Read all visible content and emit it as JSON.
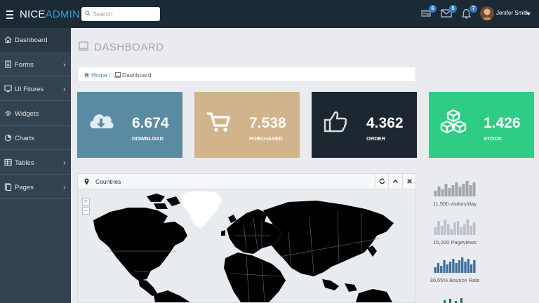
{
  "brand": {
    "part1": "NICE",
    "part2": "ADMIN"
  },
  "search": {
    "placeholder": "Search"
  },
  "notifications": [
    {
      "icon": "tasks-icon",
      "count": "6"
    },
    {
      "icon": "mail-icon",
      "count": "5"
    },
    {
      "icon": "bell-icon",
      "count": "7"
    }
  ],
  "user": {
    "name": "Jenifer Smith"
  },
  "sidebar": {
    "items": [
      {
        "label": "Dashboard",
        "icon": "home-icon",
        "has_submenu": false,
        "active": true
      },
      {
        "label": "Forms",
        "icon": "document-icon",
        "has_submenu": true
      },
      {
        "label": "UI Fitures",
        "icon": "desktop-icon",
        "has_submenu": true
      },
      {
        "label": "Widgets",
        "icon": "gear-icon",
        "has_submenu": false
      },
      {
        "label": "Charts",
        "icon": "pie-chart-icon",
        "has_submenu": false
      },
      {
        "label": "Tables",
        "icon": "table-icon",
        "has_submenu": true
      },
      {
        "label": "Pages",
        "icon": "pages-icon",
        "has_submenu": true
      }
    ]
  },
  "page": {
    "title": "DASHBOARD"
  },
  "breadcrumb": {
    "home": "Home",
    "separator": "/",
    "current": "Dashboard"
  },
  "tiles": [
    {
      "value": "6.674",
      "label": "DOWNLOAD",
      "icon": "cloud-download-icon",
      "color": "#5b8aa3"
    },
    {
      "value": "7.538",
      "label": "PURCHASED",
      "icon": "shopping-cart-icon",
      "color": "#d2b48c"
    },
    {
      "value": "4.362",
      "label": "ORDER",
      "icon": "thumbs-up-icon",
      "color": "#1d2730"
    },
    {
      "value": "1.426",
      "label": "STOCK",
      "icon": "cubes-icon",
      "color": "#2ecc84"
    }
  ],
  "map_panel": {
    "title": "Countries",
    "zoom_in": "+",
    "zoom_out": "−"
  },
  "stats": [
    {
      "caption": "11,500 visitors/day",
      "color": "#a0a6ad",
      "values": [
        4,
        7,
        5,
        9,
        6,
        8,
        10,
        7,
        9,
        11,
        8,
        10
      ]
    },
    {
      "caption": "15,000 Pageviews",
      "color": "#b9c2ca",
      "values": [
        5,
        9,
        6,
        10,
        7,
        4,
        8,
        9,
        5,
        7,
        10,
        6,
        8
      ]
    },
    {
      "caption": "30.55% Bounce Rate",
      "color": "#3d6f9a",
      "values": [
        4,
        7,
        5,
        9,
        6,
        8,
        10,
        7,
        9,
        11,
        8,
        10,
        6,
        9
      ]
    }
  ],
  "colors": {
    "header": "#1b2a35",
    "sidebar": "#344351",
    "accent": "#3a9ad9",
    "badge": "#2d7fd6",
    "content_bg": "#e9ebee"
  }
}
